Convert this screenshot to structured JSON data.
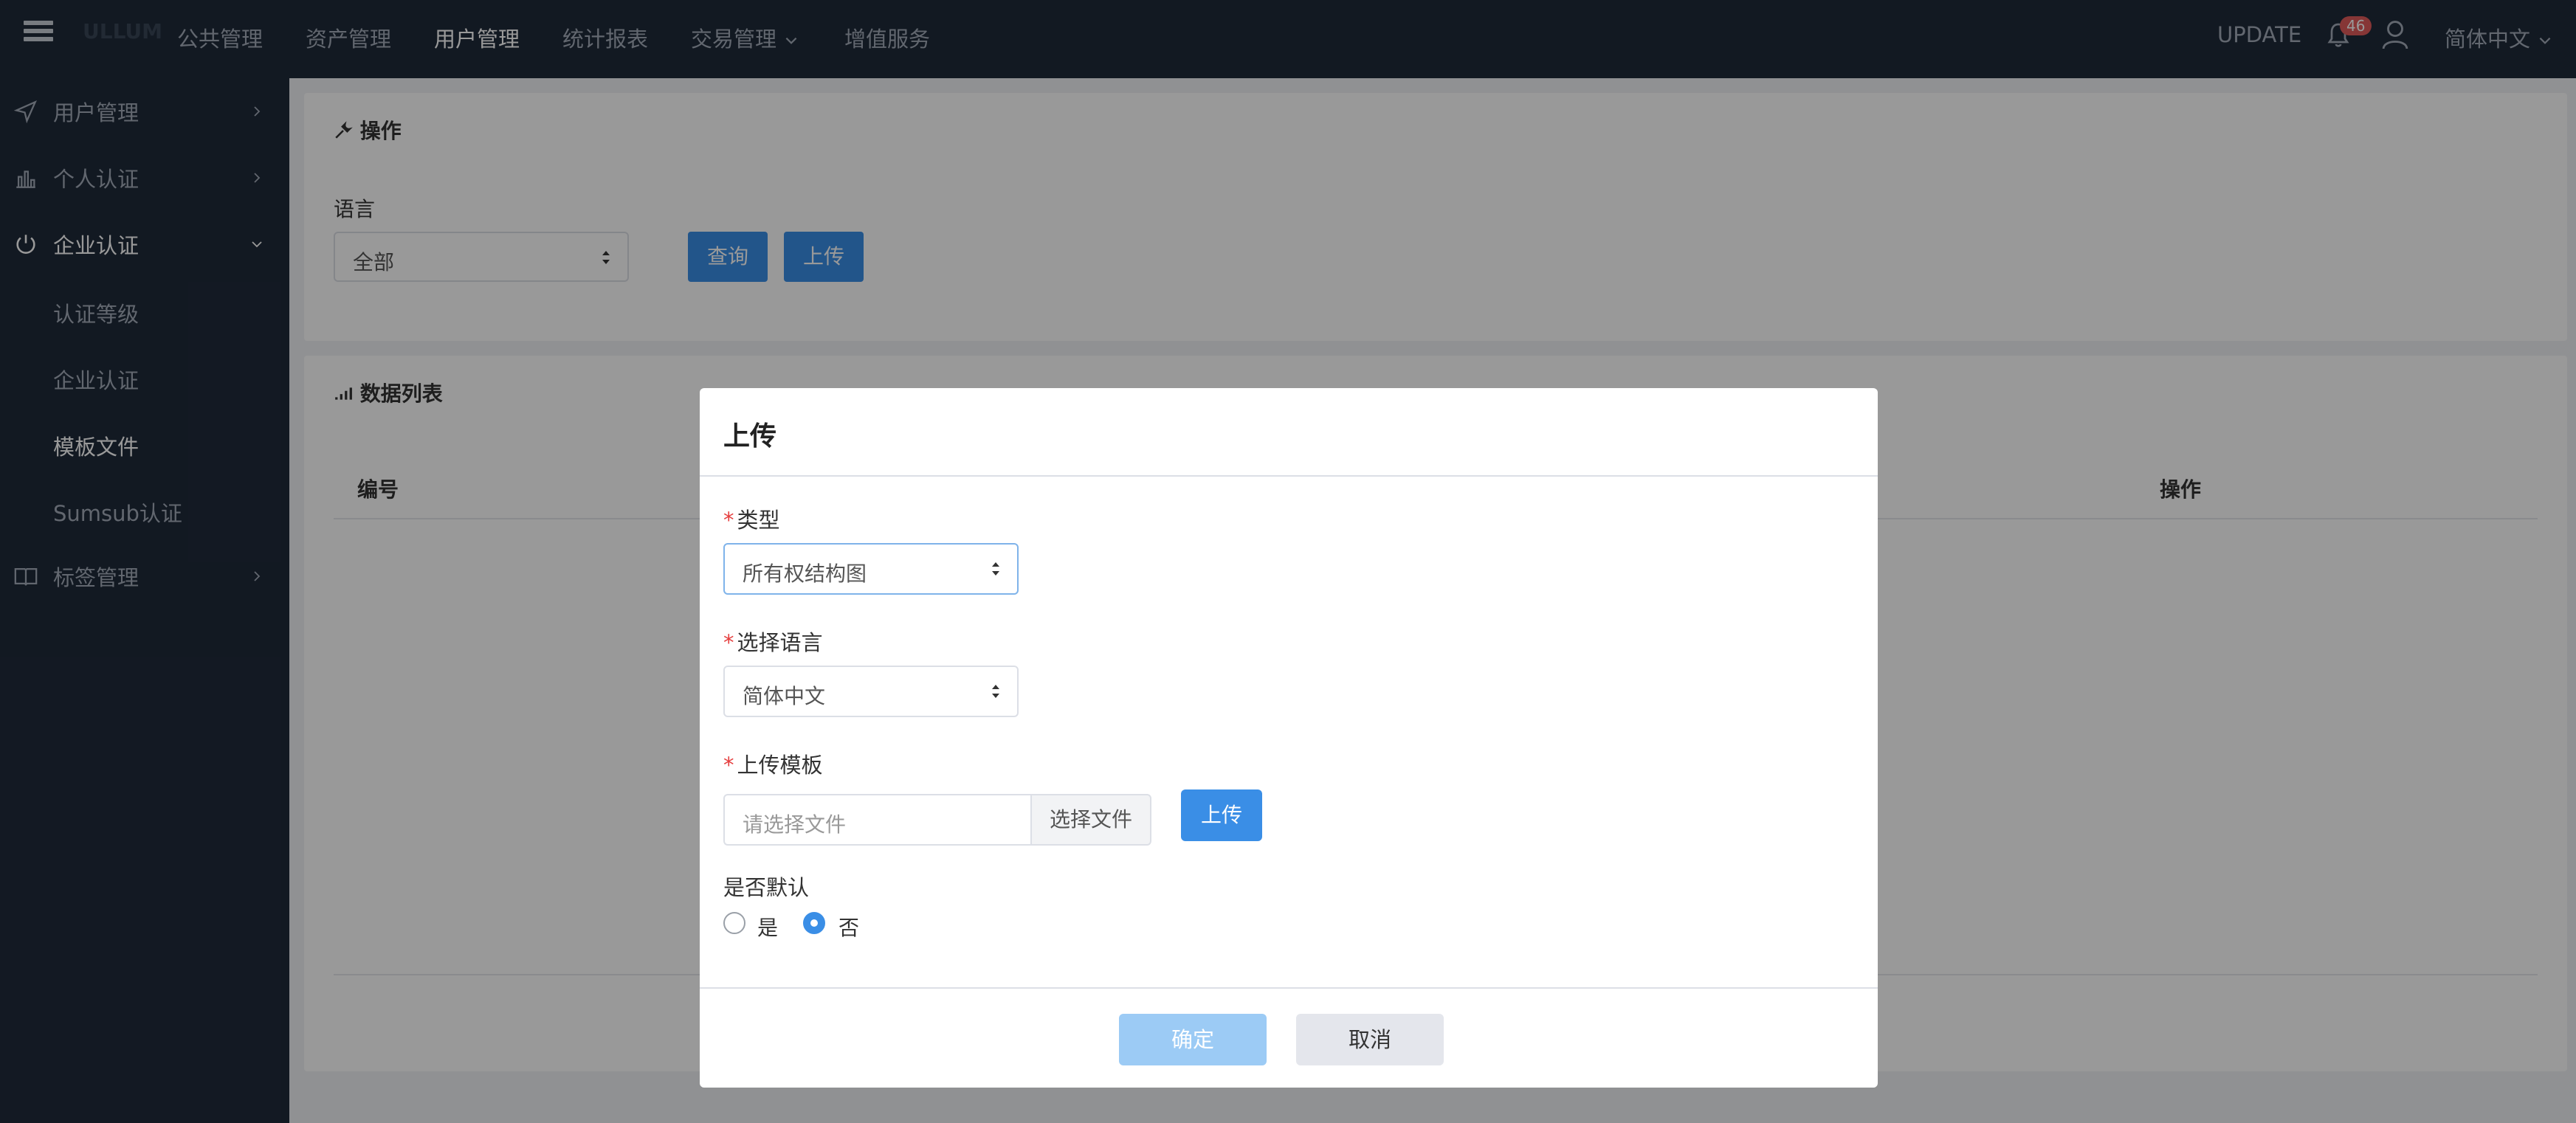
{
  "header": {
    "logo_text": "ULLUM",
    "nav": [
      "公共管理",
      "资产管理",
      "用户管理",
      "统计报表",
      "交易管理",
      "增值服务"
    ],
    "active_nav": "用户管理",
    "update_label": "UPDATE",
    "notification_count": "46",
    "language": "简体中文"
  },
  "sidebar": {
    "items": [
      {
        "label": "用户管理",
        "icon": "send-icon"
      },
      {
        "label": "个人认证",
        "icon": "bar-chart-icon"
      },
      {
        "label": "企业认证",
        "icon": "power-icon"
      },
      {
        "label": "标签管理",
        "icon": "book-icon"
      }
    ],
    "sub_items": [
      "认证等级",
      "企业认证",
      "模板文件",
      "Sumsub认证"
    ],
    "active_sub": "模板文件"
  },
  "ops_panel": {
    "title": "操作",
    "language_label": "语言",
    "language_value": "全部",
    "query_button": "查询",
    "upload_button": "上传"
  },
  "list_panel": {
    "title": "数据列表",
    "columns": [
      "编号",
      "操作"
    ]
  },
  "modal": {
    "title": "上传",
    "type_label": "类型",
    "type_value": "所有权结构图",
    "lang_label": "选择语言",
    "lang_value": "简体中文",
    "template_label": "上传模板",
    "file_placeholder": "请选择文件",
    "choose_file_button": "选择文件",
    "upload_button": "上传",
    "default_label": "是否默认",
    "radio_yes": "是",
    "radio_no": "否",
    "default_selected": "否",
    "confirm_button": "确定",
    "cancel_button": "取消"
  },
  "colors": {
    "nav_bg": "#1f2a3a",
    "primary": "#3a8ee6",
    "danger": "#e05a5a"
  }
}
